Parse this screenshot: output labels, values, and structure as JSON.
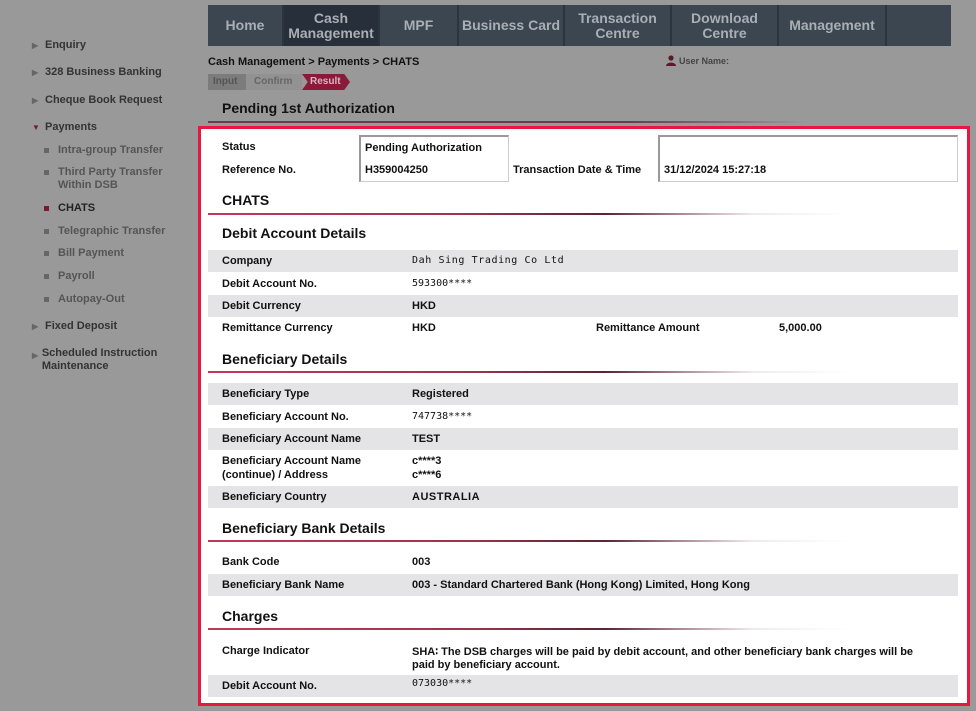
{
  "topnav": {
    "tabs": [
      {
        "label": "Home",
        "active": false
      },
      {
        "label": "Cash Management",
        "active": true
      },
      {
        "label": "MPF",
        "active": false
      },
      {
        "label": "Business Card",
        "active": false
      },
      {
        "label": "Transaction Centre",
        "active": false
      },
      {
        "label": "Download Centre",
        "active": false
      },
      {
        "label": "Management",
        "active": false
      }
    ]
  },
  "sidebar": {
    "items": [
      {
        "label": "Enquiry",
        "icon": "triangle-right-icon"
      },
      {
        "label": "328 Business Banking",
        "icon": "triangle-right-icon"
      },
      {
        "label": "Cheque Book Request",
        "icon": "triangle-right-icon"
      },
      {
        "label": "Payments",
        "icon": "triangle-down-icon",
        "expanded": true
      },
      {
        "label": "Fixed Deposit",
        "icon": "triangle-right-icon"
      },
      {
        "label": "Scheduled Instruction Maintenance",
        "icon": "triangle-right-icon"
      }
    ],
    "payments_sub": [
      {
        "label": "Intra-group Transfer"
      },
      {
        "label": "Third Party Transfer Within DSB"
      },
      {
        "label": "CHATS",
        "active": true
      },
      {
        "label": "Telegraphic Transfer"
      },
      {
        "label": "Bill Payment"
      },
      {
        "label": "Payroll"
      },
      {
        "label": "Autopay-Out"
      }
    ]
  },
  "breadcrumb": "Cash Management > Payments > CHATS",
  "user": {
    "label": "User Name:",
    "icon": "user-icon"
  },
  "steps": [
    "Input",
    "Confirm",
    "Result"
  ],
  "current_step": "Result",
  "page_title": "Pending 1st Authorization",
  "summary": {
    "status_label": "Status",
    "status_value": "Pending Authorization",
    "reference_label": "Reference No.",
    "reference_value": "H359004250",
    "datetime_label": "Transaction Date & Time",
    "datetime_value": "31/12/2024 15:27:18"
  },
  "payment_type": "CHATS",
  "debit": {
    "title": "Debit Account Details",
    "company_label": "Company",
    "company_value": "Dah Sing Trading Co Ltd",
    "account_label": "Debit Account No.",
    "account_value": "593300****",
    "currency_label": "Debit Currency",
    "currency_value": "HKD",
    "remit_currency_label": "Remittance Currency",
    "remit_currency_value": "HKD",
    "remit_amount_label": "Remittance Amount",
    "remit_amount_value": "5,000.00"
  },
  "beneficiary": {
    "title": "Beneficiary Details",
    "type_label": "Beneficiary Type",
    "type_value": "Registered",
    "account_label": "Beneficiary Account No.",
    "account_value": "747738****",
    "name_label": "Beneficiary Account Name",
    "name_value": "TEST",
    "name_cont_label_1": "Beneficiary Account Name",
    "name_cont_label_2": "(continue) / Address",
    "name_cont_value_1": "c****3",
    "name_cont_value_2": "c****6",
    "country_label": "Beneficiary Country",
    "country_value": "AUSTRALIA"
  },
  "bank": {
    "title": "Beneficiary Bank Details",
    "code_label": "Bank Code",
    "code_value": "003",
    "name_label": "Beneficiary Bank Name",
    "name_value": "003 - Standard Chartered Bank (Hong Kong) Limited, Hong Kong"
  },
  "charges": {
    "title": "Charges",
    "indicator_label": "Charge Indicator",
    "indicator_value_1": "SHA∶ The DSB charges will be paid by debit account, and other beneficiary bank charges will be",
    "indicator_value_2": "paid by beneficiary account.",
    "account_label": "Debit Account No.",
    "account_value": "073030****"
  },
  "colors": {
    "accent": "#8b1a3a",
    "highlight_border": "#e8173f",
    "nav_bg": "#3b4650"
  }
}
